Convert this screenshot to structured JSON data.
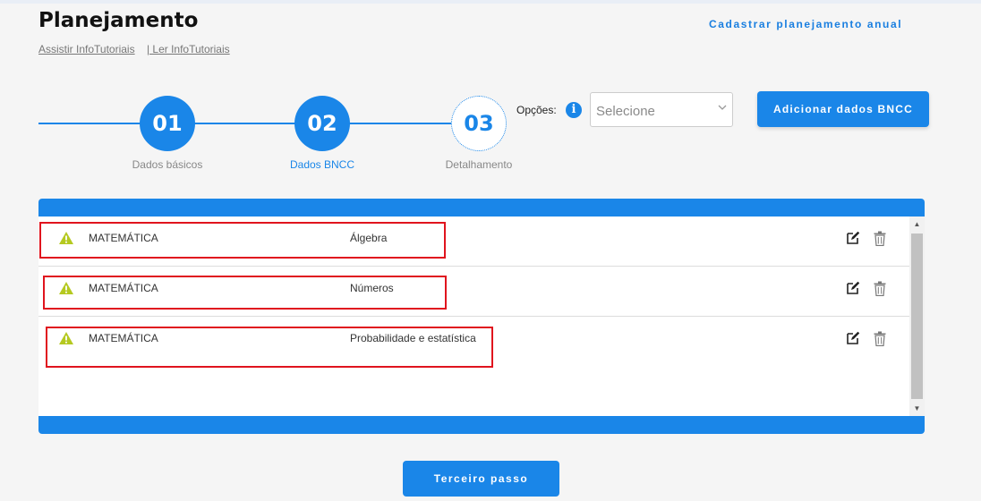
{
  "header": {
    "title": "Planejamento",
    "tutorial_watch": "Assistir InfoTutoriais",
    "tutorial_read": "| Ler InfoTutoriais",
    "annual_link": "Cadastrar planejamento anual"
  },
  "stepper": {
    "steps": [
      {
        "number": "01",
        "label": "Dados básicos"
      },
      {
        "number": "02",
        "label": "Dados BNCC"
      },
      {
        "number": "03",
        "label": "Detalhamento"
      }
    ]
  },
  "options": {
    "label": "Opções:",
    "info_icon": "i",
    "select_value": "Selecione"
  },
  "buttons": {
    "add_bncc": "Adicionar dados BNCC",
    "next_step": "Terceiro passo"
  },
  "rows": [
    {
      "subject": "MATEMÁTICA",
      "topic": "Álgebra"
    },
    {
      "subject": "MATEMÁTICA",
      "topic": "Números"
    },
    {
      "subject": "MATEMÁTICA",
      "topic": "Probabilidade e estatística"
    }
  ],
  "colors": {
    "accent": "#1a86e8",
    "warning": "#b5c920",
    "highlight": "#e0141e"
  }
}
